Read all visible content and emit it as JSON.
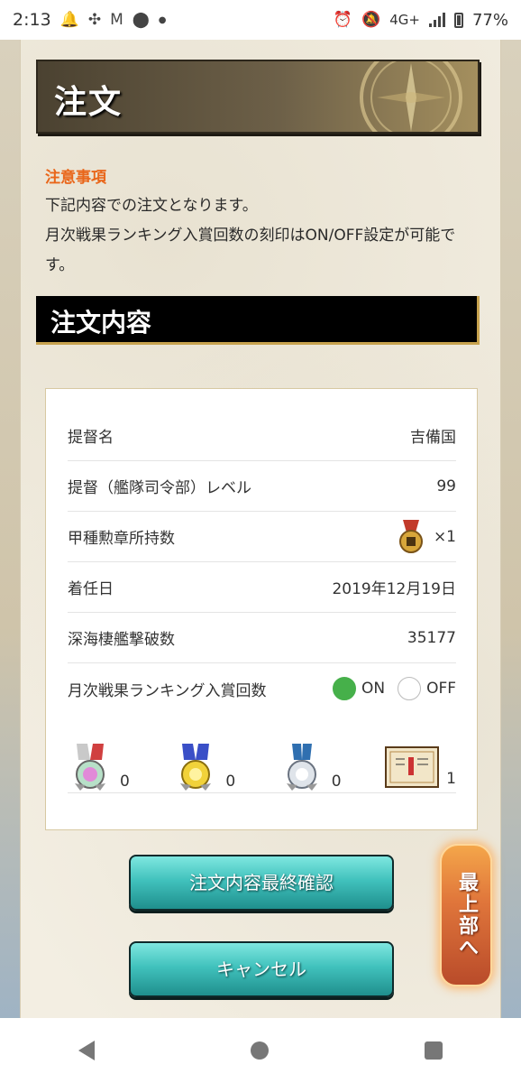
{
  "status_bar": {
    "time": "2:13",
    "network": "4G+",
    "battery": "77%",
    "icons": [
      "bell-icon",
      "pinwheel-icon",
      "gmail-icon",
      "location-icon",
      "dot-icon",
      "alarm-icon",
      "mute-icon",
      "signal-icon",
      "battery-icon"
    ]
  },
  "page": {
    "title": "注文",
    "notice": {
      "heading": "注意事項",
      "line1": "下記内容での注文となります。",
      "line2": "月次戦果ランキング入賞回数の刻印はON/OFF設定が可能です。"
    },
    "section_title": "注文内容"
  },
  "order": {
    "rows": [
      {
        "label": "提督名",
        "value": "吉備国"
      },
      {
        "label": "提督（艦隊司令部）レベル",
        "value": "99"
      },
      {
        "label": "甲種勲章所持数",
        "value": "×1"
      },
      {
        "label": "着任日",
        "value": "2019年12月19日"
      },
      {
        "label": "深海棲艦撃破数",
        "value": "35177"
      },
      {
        "label": "月次戦果ランキング入賞回数",
        "on_label": "ON",
        "off_label": "OFF",
        "selected": "ON"
      }
    ],
    "medals": [
      {
        "name": "rainbow-medal",
        "count": "0"
      },
      {
        "name": "gold-medal",
        "count": "0"
      },
      {
        "name": "silver-medal",
        "count": "0"
      },
      {
        "name": "certificate",
        "count": "1"
      }
    ]
  },
  "buttons": {
    "confirm": "注文内容最終確認",
    "cancel": "キャンセル",
    "scroll_top": "最上部へ"
  },
  "colors": {
    "accent_orange": "#e9661a",
    "button_teal": "#41c2bd",
    "radio_on": "#46b04a"
  }
}
